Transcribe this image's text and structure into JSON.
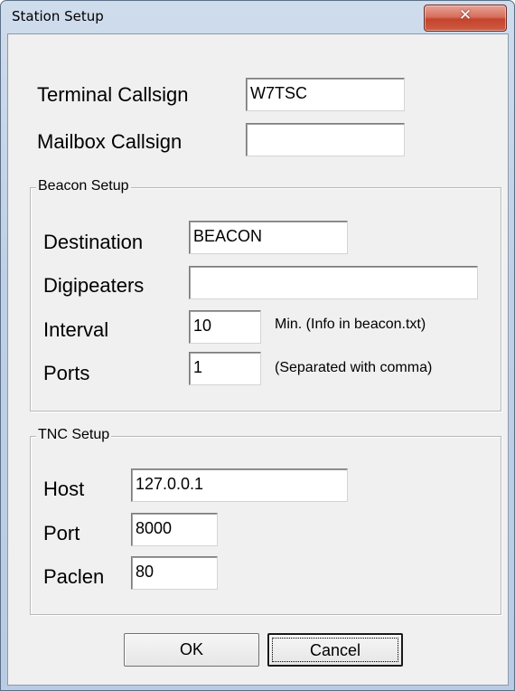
{
  "window": {
    "title": "Station Setup",
    "close_icon": "x-close-icon"
  },
  "station": {
    "terminal_callsign_label": "Terminal Callsign",
    "terminal_callsign_value": "W7TSC",
    "mailbox_callsign_label": "Mailbox Callsign",
    "mailbox_callsign_value": ""
  },
  "beacon": {
    "group_title": "Beacon Setup",
    "destination_label": "Destination",
    "destination_value": "BEACON",
    "digipeaters_label": "Digipeaters",
    "digipeaters_value": "",
    "interval_label": "Interval",
    "interval_value": "10",
    "interval_note": "Min.  (Info in beacon.txt)",
    "ports_label": "Ports",
    "ports_value": "1",
    "ports_note": "(Separated with comma)"
  },
  "tnc": {
    "group_title": "TNC Setup",
    "host_label": "Host",
    "host_value": "127.0.0.1",
    "port_label": "Port",
    "port_value": "8000",
    "paclen_label": "Paclen",
    "paclen_value": "80"
  },
  "buttons": {
    "ok_label": "OK",
    "cancel_label": "Cancel"
  }
}
